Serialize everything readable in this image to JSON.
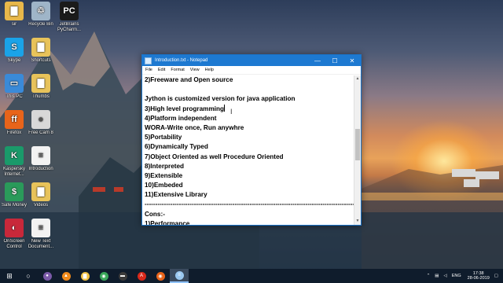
{
  "desktop": {
    "icons": [
      {
        "label": "sir",
        "glyph": "▇",
        "color": "#e8b84a"
      },
      {
        "label": "Recycle Bin",
        "glyph": "♲",
        "color": "#9fb5c8"
      },
      {
        "label": "JetBrains PyCharm...",
        "glyph": "PC",
        "color": "#1b1b1b"
      },
      {
        "label": "Skype",
        "glyph": "S",
        "color": "#1aa3e8"
      },
      {
        "label": "Shortcuts",
        "glyph": "▇",
        "color": "#e8c35a"
      },
      {
        "label": "This PC",
        "glyph": "▭",
        "color": "#3a8ad8"
      },
      {
        "label": "Thumbs",
        "glyph": "▇",
        "color": "#e8c35a"
      },
      {
        "label": "Firefox",
        "glyph": "ff",
        "color": "#e8641a"
      },
      {
        "label": "Free Cam 8",
        "glyph": "●",
        "color": "#d8d8d8"
      },
      {
        "label": "Kaspersky Internet...",
        "glyph": "K",
        "color": "#1a9a6a"
      },
      {
        "label": "Introduction",
        "glyph": "≡",
        "color": "#f2f2f2"
      },
      {
        "label": "Safe Money",
        "glyph": "$",
        "color": "#2a9a5a"
      },
      {
        "label": "Videos",
        "glyph": "▇",
        "color": "#e8c35a"
      },
      {
        "label": "OnScreen Control",
        "glyph": "◐",
        "color": "#c8283a"
      },
      {
        "label": "New Text Document...",
        "glyph": "≡",
        "color": "#f2f2f2"
      }
    ]
  },
  "notepad": {
    "title": "Introduction.txt - Notepad",
    "controls": {
      "minimize": "—",
      "maximize": "☐",
      "close": "✕"
    },
    "menu": [
      "File",
      "Edit",
      "Format",
      "View",
      "Help"
    ],
    "lines": [
      "2)Freeware and Open source",
      "",
      "Jython is customized version for java application",
      "3)High level programming",
      "4)Platform independent",
      "WORA-Write once, Run anywhre",
      "5)Portability",
      "6)Dynamically Typed",
      "7)Object Oriented as well Procedure Oriented",
      "8)Interpreted",
      "9)Extensible",
      "10)Embeded",
      "11)Extensive Library",
      "--------------------------------------------------------------------------------------------------------",
      "Cons:-",
      "1)Performance"
    ],
    "scrollbar": {
      "up": "▲",
      "down": "▼",
      "position_fraction": 0.45
    }
  },
  "taskbar": {
    "start_icon": "⊞",
    "search_icon": "○",
    "apps": [
      {
        "name": "obs",
        "glyph": "●",
        "color": "#7a5aa8"
      },
      {
        "name": "vlc",
        "glyph": "▲",
        "color": "#f08a1a"
      },
      {
        "name": "explorer",
        "glyph": "▇",
        "color": "#f0c040"
      },
      {
        "name": "chrome",
        "glyph": "◉",
        "color": "#3aa85a"
      },
      {
        "name": "terminal",
        "glyph": "▬",
        "color": "#3a3a3a"
      },
      {
        "name": "acrobat",
        "glyph": "A",
        "color": "#d8281a"
      },
      {
        "name": "firefox",
        "glyph": "◉",
        "color": "#e8641a"
      },
      {
        "name": "notepad",
        "glyph": "≡",
        "color": "#9ac8f0"
      }
    ],
    "tray": {
      "language": "ENG",
      "time": "17:38",
      "date": "28-06-2019"
    }
  }
}
